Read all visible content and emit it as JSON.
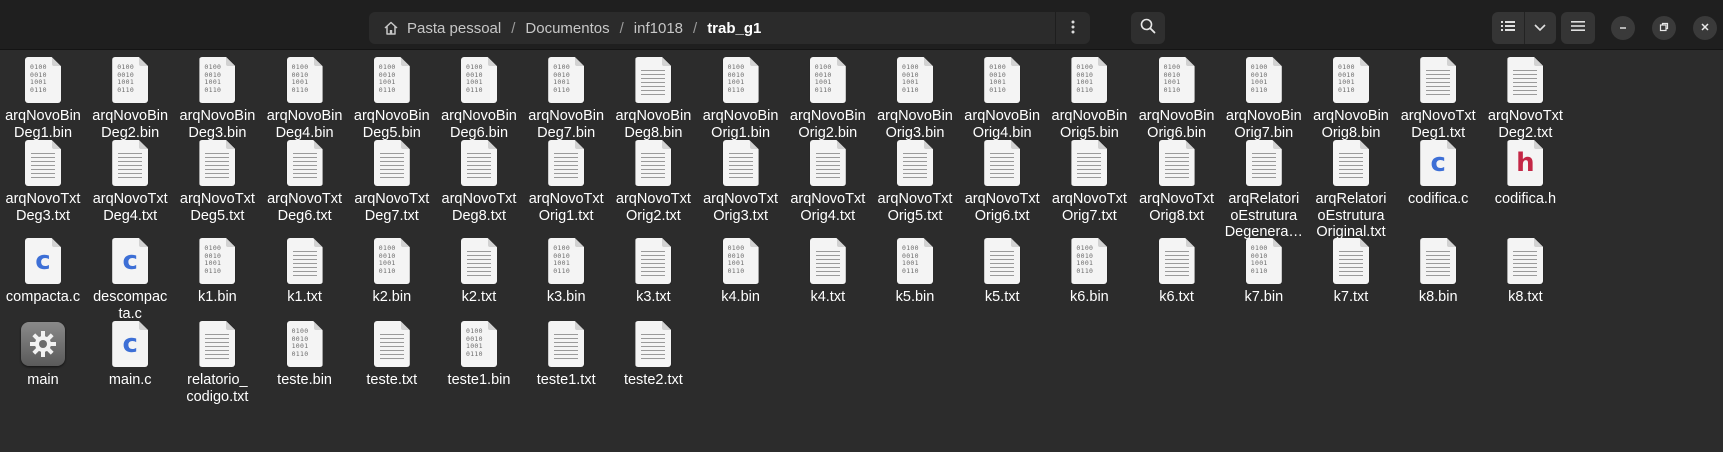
{
  "breadcrumb": [
    {
      "label": "Pasta pessoal",
      "home": true
    },
    {
      "label": "Documentos"
    },
    {
      "label": "inf1018"
    },
    {
      "label": "trab_g1",
      "current": true
    }
  ],
  "icons": {
    "home": "home-icon",
    "path_menu": "vertical-dots-icon",
    "search": "search-icon",
    "list_view": "list-view-icon",
    "view_options": "chevron-down-icon",
    "main_menu": "hamburger-menu-icon",
    "minimize": "minimize-icon",
    "maximize": "restore-icon",
    "close": "close-icon"
  },
  "colors": {
    "background": "#2c2c2c",
    "header": "#1f1f1f",
    "c_source": "#3d6fd6",
    "h_header": "#c42746"
  },
  "binary_glyph": [
    "0100",
    "0010",
    "1001",
    "0110"
  ],
  "files": [
    {
      "name": "arqNovoBinDeg1.bin",
      "lines": [
        "arqNovoBin",
        "Deg1.bin"
      ],
      "type": "bin"
    },
    {
      "name": "arqNovoBinDeg2.bin",
      "lines": [
        "arqNovoBin",
        "Deg2.bin"
      ],
      "type": "bin"
    },
    {
      "name": "arqNovoBinDeg3.bin",
      "lines": [
        "arqNovoBin",
        "Deg3.bin"
      ],
      "type": "bin"
    },
    {
      "name": "arqNovoBinDeg4.bin",
      "lines": [
        "arqNovoBin",
        "Deg4.bin"
      ],
      "type": "bin"
    },
    {
      "name": "arqNovoBinDeg5.bin",
      "lines": [
        "arqNovoBin",
        "Deg5.bin"
      ],
      "type": "bin"
    },
    {
      "name": "arqNovoBinDeg6.bin",
      "lines": [
        "arqNovoBin",
        "Deg6.bin"
      ],
      "type": "bin"
    },
    {
      "name": "arqNovoBinDeg7.bin",
      "lines": [
        "arqNovoBin",
        "Deg7.bin"
      ],
      "type": "bin"
    },
    {
      "name": "arqNovoBinDeg8.bin",
      "lines": [
        "arqNovoBin",
        "Deg8.bin"
      ],
      "type": "txt"
    },
    {
      "name": "arqNovoBinOrig1.bin",
      "lines": [
        "arqNovoBin",
        "Orig1.bin"
      ],
      "type": "bin"
    },
    {
      "name": "arqNovoBinOrig2.bin",
      "lines": [
        "arqNovoBin",
        "Orig2.bin"
      ],
      "type": "bin"
    },
    {
      "name": "arqNovoBinOrig3.bin",
      "lines": [
        "arqNovoBin",
        "Orig3.bin"
      ],
      "type": "bin"
    },
    {
      "name": "arqNovoBinOrig4.bin",
      "lines": [
        "arqNovoBin",
        "Orig4.bin"
      ],
      "type": "bin"
    },
    {
      "name": "arqNovoBinOrig5.bin",
      "lines": [
        "arqNovoBin",
        "Orig5.bin"
      ],
      "type": "bin"
    },
    {
      "name": "arqNovoBinOrig6.bin",
      "lines": [
        "arqNovoBin",
        "Orig6.bin"
      ],
      "type": "bin"
    },
    {
      "name": "arqNovoBinOrig7.bin",
      "lines": [
        "arqNovoBin",
        "Orig7.bin"
      ],
      "type": "bin"
    },
    {
      "name": "arqNovoBinOrig8.bin",
      "lines": [
        "arqNovoBin",
        "Orig8.bin"
      ],
      "type": "bin"
    },
    {
      "name": "arqNovoTxtDeg1.txt",
      "lines": [
        "arqNovoTxt",
        "Deg1.txt"
      ],
      "type": "txt"
    },
    {
      "name": "arqNovoTxtDeg2.txt",
      "lines": [
        "arqNovoTxt",
        "Deg2.txt"
      ],
      "type": "txt"
    },
    {
      "name": "arqNovoTxtDeg3.txt",
      "lines": [
        "arqNovoTxt",
        "Deg3.txt"
      ],
      "type": "txt"
    },
    {
      "name": "arqNovoTxtDeg4.txt",
      "lines": [
        "arqNovoTxt",
        "Deg4.txt"
      ],
      "type": "txt"
    },
    {
      "name": "arqNovoTxtDeg5.txt",
      "lines": [
        "arqNovoTxt",
        "Deg5.txt"
      ],
      "type": "txt"
    },
    {
      "name": "arqNovoTxtDeg6.txt",
      "lines": [
        "arqNovoTxt",
        "Deg6.txt"
      ],
      "type": "txt"
    },
    {
      "name": "arqNovoTxtDeg7.txt",
      "lines": [
        "arqNovoTxt",
        "Deg7.txt"
      ],
      "type": "txt"
    },
    {
      "name": "arqNovoTxtDeg8.txt",
      "lines": [
        "arqNovoTxt",
        "Deg8.txt"
      ],
      "type": "txt"
    },
    {
      "name": "arqNovoTxtOrig1.txt",
      "lines": [
        "arqNovoTxt",
        "Orig1.txt"
      ],
      "type": "txt"
    },
    {
      "name": "arqNovoTxtOrig2.txt",
      "lines": [
        "arqNovoTxt",
        "Orig2.txt"
      ],
      "type": "txt"
    },
    {
      "name": "arqNovoTxtOrig3.txt",
      "lines": [
        "arqNovoTxt",
        "Orig3.txt"
      ],
      "type": "txt"
    },
    {
      "name": "arqNovoTxtOrig4.txt",
      "lines": [
        "arqNovoTxt",
        "Orig4.txt"
      ],
      "type": "txt"
    },
    {
      "name": "arqNovoTxtOrig5.txt",
      "lines": [
        "arqNovoTxt",
        "Orig5.txt"
      ],
      "type": "txt"
    },
    {
      "name": "arqNovoTxtOrig6.txt",
      "lines": [
        "arqNovoTxt",
        "Orig6.txt"
      ],
      "type": "txt"
    },
    {
      "name": "arqNovoTxtOrig7.txt",
      "lines": [
        "arqNovoTxt",
        "Orig7.txt"
      ],
      "type": "txt"
    },
    {
      "name": "arqNovoTxtOrig8.txt",
      "lines": [
        "arqNovoTxt",
        "Orig8.txt"
      ],
      "type": "txt"
    },
    {
      "name": "arqRelatorioEstruturaDegenera…",
      "lines": [
        "arqRelatori",
        "oEstrutura",
        "Degenera…"
      ],
      "type": "txt"
    },
    {
      "name": "arqRelatorioEstruturaOriginal.txt",
      "lines": [
        "arqRelatori",
        "oEstrutura",
        "Original.txt"
      ],
      "type": "txt"
    },
    {
      "name": "codifica.c",
      "lines": [
        "codifica.c"
      ],
      "type": "c"
    },
    {
      "name": "codifica.h",
      "lines": [
        "codifica.h"
      ],
      "type": "h"
    },
    {
      "name": "compacta.c",
      "lines": [
        "compacta.c"
      ],
      "type": "c"
    },
    {
      "name": "descompacta.c",
      "lines": [
        "descompac",
        "ta.c"
      ],
      "type": "c"
    },
    {
      "name": "k1.bin",
      "lines": [
        "k1.bin"
      ],
      "type": "bin"
    },
    {
      "name": "k1.txt",
      "lines": [
        "k1.txt"
      ],
      "type": "txt"
    },
    {
      "name": "k2.bin",
      "lines": [
        "k2.bin"
      ],
      "type": "bin"
    },
    {
      "name": "k2.txt",
      "lines": [
        "k2.txt"
      ],
      "type": "txt"
    },
    {
      "name": "k3.bin",
      "lines": [
        "k3.bin"
      ],
      "type": "bin"
    },
    {
      "name": "k3.txt",
      "lines": [
        "k3.txt"
      ],
      "type": "txt"
    },
    {
      "name": "k4.bin",
      "lines": [
        "k4.bin"
      ],
      "type": "bin"
    },
    {
      "name": "k4.txt",
      "lines": [
        "k4.txt"
      ],
      "type": "txt"
    },
    {
      "name": "k5.bin",
      "lines": [
        "k5.bin"
      ],
      "type": "bin"
    },
    {
      "name": "k5.txt",
      "lines": [
        "k5.txt"
      ],
      "type": "txt"
    },
    {
      "name": "k6.bin",
      "lines": [
        "k6.bin"
      ],
      "type": "bin"
    },
    {
      "name": "k6.txt",
      "lines": [
        "k6.txt"
      ],
      "type": "txt"
    },
    {
      "name": "k7.bin",
      "lines": [
        "k7.bin"
      ],
      "type": "bin"
    },
    {
      "name": "k7.txt",
      "lines": [
        "k7.txt"
      ],
      "type": "txt"
    },
    {
      "name": "k8.bin",
      "lines": [
        "k8.bin"
      ],
      "type": "txt"
    },
    {
      "name": "k8.txt",
      "lines": [
        "k8.txt"
      ],
      "type": "txt"
    },
    {
      "name": "main",
      "lines": [
        "main"
      ],
      "type": "exec"
    },
    {
      "name": "main.c",
      "lines": [
        "main.c"
      ],
      "type": "c"
    },
    {
      "name": "relatorio_codigo.txt",
      "lines": [
        "relatorio_",
        "codigo.txt"
      ],
      "type": "txt"
    },
    {
      "name": "teste.bin",
      "lines": [
        "teste.bin"
      ],
      "type": "bin"
    },
    {
      "name": "teste.txt",
      "lines": [
        "teste.txt"
      ],
      "type": "txt"
    },
    {
      "name": "teste1.bin",
      "lines": [
        "teste1.bin"
      ],
      "type": "bin"
    },
    {
      "name": "teste1.txt",
      "lines": [
        "teste1.txt"
      ],
      "type": "txt"
    },
    {
      "name": "teste2.txt",
      "lines": [
        "teste2.txt"
      ],
      "type": "txt"
    }
  ]
}
